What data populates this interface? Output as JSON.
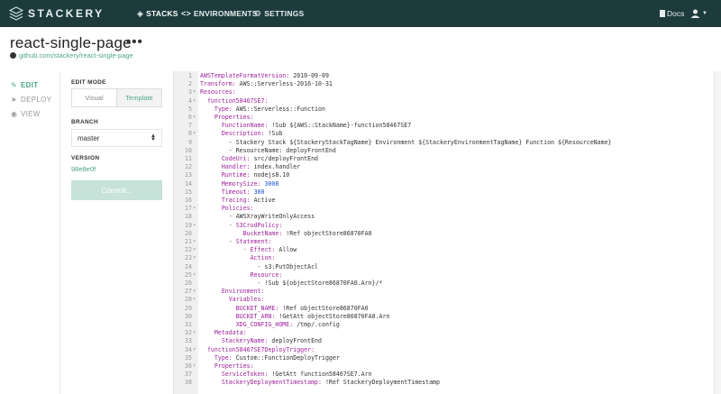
{
  "nav": {
    "brand": "STACKERY",
    "stacks": "STACKS",
    "environments": "ENVIRONMENTS",
    "settings": "SETTINGS",
    "docs": "Docs",
    "icons": {
      "logo": "stackery-logo-icon",
      "stacks": "stacks-icon",
      "environments": "code-brackets-icon",
      "settings": "gear-icon",
      "docs": "document-icon",
      "user": "user-icon"
    }
  },
  "header": {
    "title": "react-single-page",
    "more": "•••",
    "repo": "github.com/stackery/react-single-page"
  },
  "side_nav": [
    {
      "label": "EDIT",
      "icon": "pencil-icon",
      "active": true
    },
    {
      "label": "DEPLOY",
      "icon": "send-icon",
      "active": false
    },
    {
      "label": "VIEW",
      "icon": "eye-icon",
      "active": false
    }
  ],
  "panel": {
    "edit_mode_label": "EDIT MODE",
    "mode_visual": "Visual",
    "mode_template": "Template",
    "branch_label": "BRANCH",
    "branch_value": "master",
    "version_label": "VERSION",
    "version_value": "98e8e0f",
    "commit_label": "Commit..."
  },
  "colors": {
    "topnav": "#1d3b3d",
    "accent": "#4ca58c",
    "key": "#a0249c",
    "number": "#1a4fd1"
  },
  "code": [
    {
      "num": "1",
      "fold": false,
      "indent": "",
      "key": "AWSTemplateFormatVersion:",
      "val": " 2010-09-09",
      "valtype": "plain"
    },
    {
      "num": "2",
      "fold": false,
      "indent": "",
      "key": "Transform:",
      "val": " AWS::Serverless-2016-10-31",
      "valtype": "plain"
    },
    {
      "num": "3",
      "fold": true,
      "indent": "",
      "key": "Resources:",
      "val": "",
      "valtype": "plain"
    },
    {
      "num": "4",
      "fold": true,
      "indent": "  ",
      "key": "function58467SE7:",
      "val": "",
      "valtype": "plain"
    },
    {
      "num": "5",
      "fold": false,
      "indent": "    ",
      "key": "Type:",
      "val": " AWS::Serverless::Function",
      "valtype": "plain"
    },
    {
      "num": "6",
      "fold": true,
      "indent": "    ",
      "key": "Properties:",
      "val": "",
      "valtype": "plain"
    },
    {
      "num": "7",
      "fold": false,
      "indent": "      ",
      "key": "FunctionName:",
      "val": " !Sub ${AWS::StackName}-function58467SE7",
      "valtype": "plain"
    },
    {
      "num": "8",
      "fold": true,
      "indent": "      ",
      "key": "Description:",
      "val": " !Sub",
      "valtype": "plain"
    },
    {
      "num": "9",
      "fold": false,
      "indent": "        ",
      "key": "",
      "val": "- Stackery Stack ${StackeryStackTagName} Environment ${StackeryEnvironmentTagName} Function ${ResourceName}",
      "valtype": "plain"
    },
    {
      "num": "10",
      "fold": false,
      "indent": "        ",
      "key": "",
      "val": "- ResourceName: deployFrontEnd",
      "valtype": "plain"
    },
    {
      "num": "11",
      "fold": false,
      "indent": "      ",
      "key": "CodeUri:",
      "val": " src/deployFrontEnd",
      "valtype": "plain"
    },
    {
      "num": "12",
      "fold": false,
      "indent": "      ",
      "key": "Handler:",
      "val": " index.handler",
      "valtype": "plain"
    },
    {
      "num": "13",
      "fold": false,
      "indent": "      ",
      "key": "Runtime:",
      "val": " nodejs8.10",
      "valtype": "plain"
    },
    {
      "num": "14",
      "fold": false,
      "indent": "      ",
      "key": "MemorySize:",
      "val": " 3008",
      "valtype": "number"
    },
    {
      "num": "15",
      "fold": false,
      "indent": "      ",
      "key": "Timeout:",
      "val": " 300",
      "valtype": "number"
    },
    {
      "num": "16",
      "fold": false,
      "indent": "      ",
      "key": "Tracing:",
      "val": " Active",
      "valtype": "plain"
    },
    {
      "num": "17",
      "fold": true,
      "indent": "      ",
      "key": "Policies:",
      "val": "",
      "valtype": "plain"
    },
    {
      "num": "18",
      "fold": false,
      "indent": "        ",
      "key": "",
      "val": "- AWSXrayWriteOnlyAccess",
      "valtype": "plain"
    },
    {
      "num": "19",
      "fold": true,
      "indent": "        ",
      "key": "- S3CrudPolicy:",
      "val": "",
      "valtype": "plain"
    },
    {
      "num": "20",
      "fold": false,
      "indent": "            ",
      "key": "BucketName:",
      "val": " !Ref objectStore86870FA0",
      "valtype": "plain"
    },
    {
      "num": "21",
      "fold": true,
      "indent": "        ",
      "key": "- Statement:",
      "val": "",
      "valtype": "plain"
    },
    {
      "num": "22",
      "fold": true,
      "indent": "            ",
      "key": "- Effect:",
      "val": " Allow",
      "valtype": "plain"
    },
    {
      "num": "23",
      "fold": true,
      "indent": "              ",
      "key": "Action:",
      "val": "",
      "valtype": "plain"
    },
    {
      "num": "24",
      "fold": false,
      "indent": "                ",
      "key": "",
      "val": "- s3:PutObjectAcl",
      "valtype": "plain"
    },
    {
      "num": "25",
      "fold": true,
      "indent": "              ",
      "key": "Resource:",
      "val": "",
      "valtype": "plain"
    },
    {
      "num": "26",
      "fold": false,
      "indent": "                ",
      "key": "",
      "val": "- !Sub ${objectStore86870FA0.Arn}/*",
      "valtype": "plain"
    },
    {
      "num": "27",
      "fold": true,
      "indent": "      ",
      "key": "Environment:",
      "val": "",
      "valtype": "plain"
    },
    {
      "num": "28",
      "fold": true,
      "indent": "        ",
      "key": "Variables:",
      "val": "",
      "valtype": "plain"
    },
    {
      "num": "29",
      "fold": false,
      "indent": "          ",
      "key": "BUCKET_NAME:",
      "val": " !Ref objectStore86870FA0",
      "valtype": "plain"
    },
    {
      "num": "30",
      "fold": false,
      "indent": "          ",
      "key": "BUCKET_ARN:",
      "val": " !GetAtt objectStore86870FA0.Arn",
      "valtype": "plain"
    },
    {
      "num": "31",
      "fold": false,
      "indent": "          ",
      "key": "XDG_CONFIG_HOME:",
      "val": " /tmp/.config",
      "valtype": "plain"
    },
    {
      "num": "32",
      "fold": true,
      "indent": "    ",
      "key": "Metadata:",
      "val": "",
      "valtype": "plain"
    },
    {
      "num": "33",
      "fold": false,
      "indent": "      ",
      "key": "StackeryName:",
      "val": " deployFrontEnd",
      "valtype": "plain"
    },
    {
      "num": "34",
      "fold": true,
      "indent": "  ",
      "key": "function58467SE7DeployTrigger:",
      "val": "",
      "valtype": "plain"
    },
    {
      "num": "35",
      "fold": false,
      "indent": "    ",
      "key": "Type:",
      "val": " Custom::FunctionDeployTrigger",
      "valtype": "plain"
    },
    {
      "num": "36",
      "fold": true,
      "indent": "    ",
      "key": "Properties:",
      "val": "",
      "valtype": "plain"
    },
    {
      "num": "37",
      "fold": false,
      "indent": "      ",
      "key": "ServiceToken:",
      "val": " !GetAtt function58467SE7.Arn",
      "valtype": "plain"
    },
    {
      "num": "38",
      "fold": false,
      "indent": "      ",
      "key": "StackeryDeploymentTimestamp:",
      "val": " !Ref StackeryDeploymentTimestamp",
      "valtype": "plain"
    }
  ]
}
